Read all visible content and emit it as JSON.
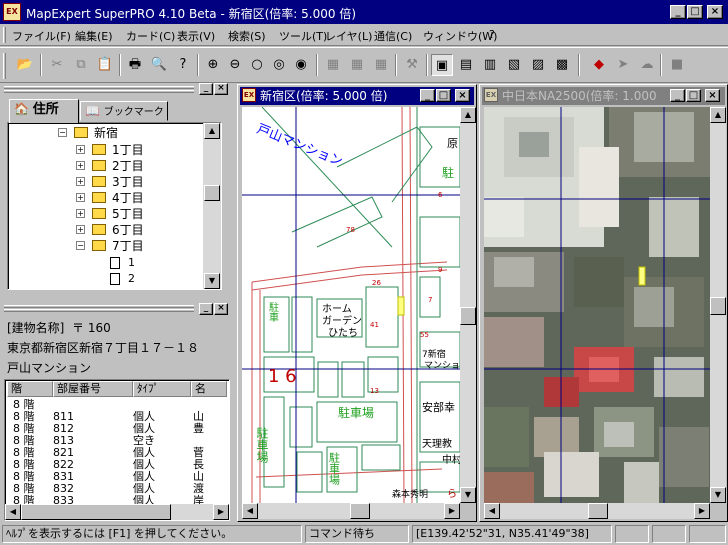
{
  "app": {
    "title": "MapExpert SuperPRO 4.10 Beta - 新宿区(倍率:  5.000 倍)",
    "icon": "app-logo-icon"
  },
  "menu": [
    "ファイル(F)",
    "編集(E)",
    "カード(C)",
    "表示(V)",
    "検索(S)",
    "ツール(T)",
    "レイヤ(L)",
    "通信(C)",
    "ウィンドウ(W)",
    "?"
  ],
  "tree": {
    "tabs": [
      "住所",
      "ブックマーク"
    ],
    "root": "新宿",
    "items": [
      "1丁目",
      "2丁目",
      "3丁目",
      "4丁目",
      "5丁目",
      "6丁目",
      "7丁目"
    ],
    "sub": [
      "1",
      "2"
    ]
  },
  "info": {
    "label": "[建物名称]",
    "postal": "〒 160",
    "address": "東京都新宿区新宿７丁目１７－１８",
    "building": "戸山マンション"
  },
  "rooms": {
    "headers": [
      "階",
      "部屋番号",
      "ﾀｲﾌﾟ",
      "名"
    ],
    "rows": [
      [
        "8 階",
        "",
        "",
        ""
      ],
      [
        "8 階",
        "811",
        "個人",
        "山"
      ],
      [
        "8 階",
        "812",
        "個人",
        "豊"
      ],
      [
        "8 階",
        "813",
        "空き",
        ""
      ],
      [
        "8 階",
        "821",
        "個人",
        "菅"
      ],
      [
        "8 階",
        "822",
        "個人",
        "長"
      ],
      [
        "8 階",
        "831",
        "個人",
        "山"
      ],
      [
        "8 階",
        "832",
        "個人",
        "渡"
      ],
      [
        "8 階",
        "833",
        "個人",
        "岸"
      ]
    ]
  },
  "map1": {
    "title": "新宿区(倍率:  5.000 倍)",
    "labels": {
      "mansion": "戸山マンション",
      "block": "1 6",
      "parking1": "駐車場",
      "parking2": "駐車場",
      "parking3": "駐車場",
      "parking4": "駐",
      "parking5": "駐車",
      "home1": "ホーム",
      "home2": "ガーデン",
      "home3": "ひたち",
      "abe": "安部幸",
      "tenri": "天理教",
      "nakamura": "中村",
      "shin1": "7新宿",
      "shin2": "マンション",
      "hara": "原",
      "n78": "78",
      "n26": "26",
      "n41": "41",
      "n55": "55",
      "n13": "13",
      "n6": "6",
      "n9": "9",
      "n7": "7",
      "nlight": "ら",
      "sm1": "森本秀明"
    }
  },
  "map2": {
    "title": "中日本NA2500(倍率:  1.000"
  },
  "status": {
    "help": "ﾍﾙﾌﾟを表示するには [F1] を押してください。",
    "command": "コマンド待ち",
    "coords": "[E139.42'52\"31, N35.41'49\"38]"
  }
}
